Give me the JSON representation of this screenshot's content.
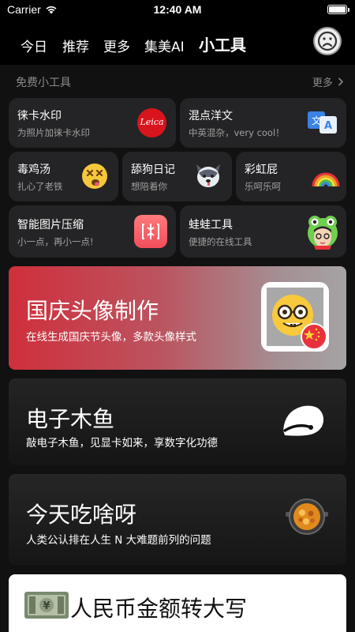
{
  "status": {
    "carrier": "Carrier",
    "time": "12:40 AM"
  },
  "tabs": [
    {
      "label": "今日"
    },
    {
      "label": "推荐"
    },
    {
      "label": "更多"
    },
    {
      "label": "集美AI"
    },
    {
      "label": "小工具",
      "active": true
    }
  ],
  "section": {
    "title": "免费小工具",
    "more": "更多"
  },
  "tools": {
    "leica": {
      "title": "徕卡水印",
      "subtitle": "为照片加徕卡水印",
      "logo_text": "Leica"
    },
    "mix": {
      "title": "混点洋文",
      "subtitle": "中英混杂，very cool！"
    },
    "soup": {
      "title": "毒鸡汤",
      "subtitle": "扎心了老铁"
    },
    "dog": {
      "title": "舔狗日记",
      "subtitle": "想陪着你"
    },
    "rainbow": {
      "title": "彩虹屁",
      "subtitle": "乐呵乐呵"
    },
    "compress": {
      "title": "智能图片压缩",
      "subtitle": "小一点，再小一点!"
    },
    "frog": {
      "title": "蛙蛙工具",
      "subtitle": "便捷的在线工具"
    }
  },
  "banners": {
    "national_day": {
      "title": "国庆头像制作",
      "subtitle": "在线生成国庆节头像，多款头像样式"
    },
    "muyu": {
      "title": "电子木鱼",
      "subtitle": "敲电子木鱼，见显卡如来，享数字化功德"
    },
    "eat": {
      "title": "今天吃啥呀",
      "subtitle": "人类公认排在人生 N 大难题前列的问题"
    },
    "rmb": {
      "title": "人民币金额转大写"
    }
  },
  "colors": {
    "background": "#000000",
    "card": "#242426",
    "subtext": "#a0a0a0",
    "red_banner": "#cf2f3b",
    "leica_red": "#d8141d"
  },
  "icons": {
    "wifi": "wifi-icon",
    "battery": "battery-icon",
    "avatar": "sad-face-avatar-icon",
    "chevron": "chevron-right-icon",
    "leica": "leica-logo-icon",
    "translate": "translate-icon",
    "dizzy": "dizzy-face-icon",
    "dog": "husky-dog-icon",
    "rainbow": "rainbow-icon",
    "compress": "compress-icon",
    "frog": "frog-icon",
    "nerd": "nerd-face-icon",
    "flag": "china-flag-icon",
    "muyu": "wooden-fish-icon",
    "pot": "hot-pot-icon",
    "money": "banknote-icon"
  }
}
